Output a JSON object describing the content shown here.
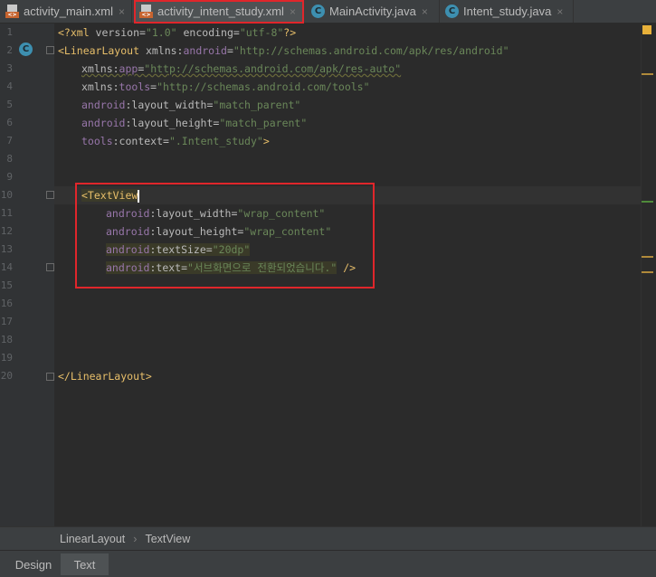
{
  "tabs": [
    {
      "label": "activity_main.xml",
      "type": "xml"
    },
    {
      "label": "activity_intent_study.xml",
      "type": "xml",
      "active": true
    },
    {
      "label": "MainActivity.java",
      "type": "class"
    },
    {
      "label": "Intent_study.java",
      "type": "class"
    }
  ],
  "tab_close_glyph": "×",
  "class_icon_letter": "C",
  "xml_icon_text": "<>",
  "line_numbers": [
    "1",
    "2",
    "3",
    "4",
    "5",
    "6",
    "7",
    "8",
    "9",
    "10",
    "11",
    "12",
    "13",
    "14",
    "15",
    "16",
    "17",
    "18",
    "19",
    "20"
  ],
  "code": {
    "l1": {
      "p1": "<?xml ",
      "p2": "version",
      "p3": "=",
      "p4": "\"1.0\"",
      "p5": " encoding",
      "p6": "=",
      "p7": "\"utf-8\"",
      "p8": "?>"
    },
    "l2": {
      "p1": "<LinearLayout ",
      "p2": "xmlns:",
      "p3": "android",
      "p4": "=",
      "p5": "\"http://schemas.android.com/apk/res/android\""
    },
    "l3": {
      "p1": "xmlns:",
      "p2": "app",
      "p3": "=",
      "p4": "\"http://schemas.android.com/apk/res-auto\""
    },
    "l4": {
      "p1": "xmlns:",
      "p2": "tools",
      "p3": "=",
      "p4": "\"http://schemas.android.com/tools\""
    },
    "l5": {
      "p1": "android",
      "p2": ":layout_width",
      "p3": "=",
      "p4": "\"match_parent\""
    },
    "l6": {
      "p1": "android",
      "p2": ":layout_height",
      "p3": "=",
      "p4": "\"match_parent\""
    },
    "l7": {
      "p1": "tools",
      "p2": ":context",
      "p3": "=",
      "p4": "\".Intent_study\"",
      "p5": ">"
    },
    "l10": {
      "p1": "<TextView"
    },
    "l11": {
      "p1": "android",
      "p2": ":layout_width",
      "p3": "=",
      "p4": "\"wrap_content\""
    },
    "l12": {
      "p1": "android",
      "p2": ":layout_height",
      "p3": "=",
      "p4": "\"wrap_content\""
    },
    "l13": {
      "p1": "android",
      "p2": ":textSize",
      "p3": "=",
      "p4": "\"20dp\""
    },
    "l14": {
      "p1": "android",
      "p2": ":text",
      "p3": "=",
      "p4": "\"서브화면으로 전환되었습니다.\"",
      "p5": " />"
    },
    "l20": {
      "p1": "</LinearLayout>"
    }
  },
  "breadcrumb": {
    "items": [
      "LinearLayout",
      "TextView"
    ],
    "separator": "›"
  },
  "bottom_tabs": [
    {
      "label": "Design"
    },
    {
      "label": "Text",
      "selected": true
    }
  ],
  "colors": {
    "tag": "#e8bf6a",
    "attribute": "#bababa",
    "namespace": "#9876aa",
    "string": "#6a8759",
    "highlight_box": "#e0262b"
  }
}
